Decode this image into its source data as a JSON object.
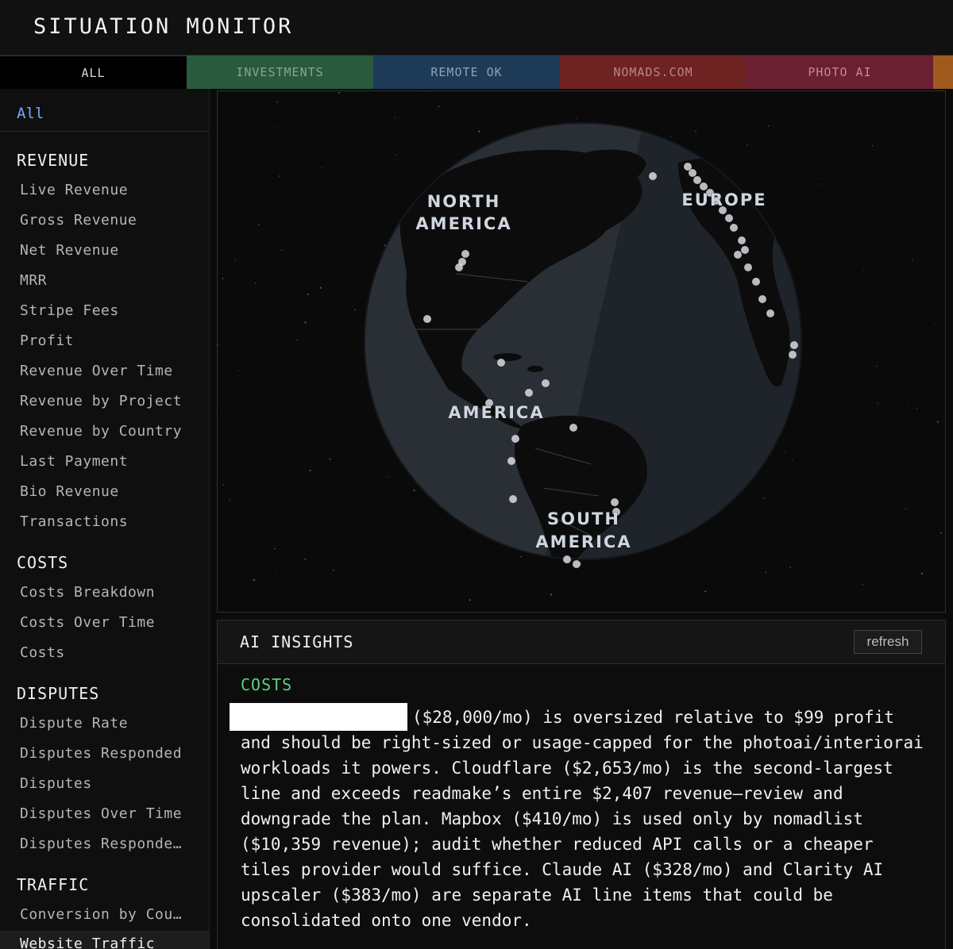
{
  "header": {
    "title": "SITUATION MONITOR"
  },
  "tabs": [
    "ALL",
    "INVESTMENTS",
    "REMOTE OK",
    "NOMADS.COM",
    "PHOTO AI"
  ],
  "sidebar": {
    "all": "All",
    "sections": {
      "revenue": {
        "title": "REVENUE",
        "items": [
          "Live Revenue",
          "Gross Revenue",
          "Net Revenue",
          "MRR",
          "Stripe Fees",
          "Profit",
          "Revenue Over Time",
          "Revenue by Project",
          "Revenue by Country",
          "Last Payment",
          "Bio Revenue",
          "Transactions"
        ]
      },
      "costs": {
        "title": "COSTS",
        "items": [
          "Costs Breakdown",
          "Costs Over Time",
          "Costs"
        ]
      },
      "disputes": {
        "title": "DISPUTES",
        "items": [
          "Dispute Rate",
          "Disputes Responded",
          "Disputes",
          "Disputes Over Time",
          "Disputes Responde…"
        ]
      },
      "traffic": {
        "title": "TRAFFIC",
        "items": [
          "Conversion by Cou…",
          "Website Traffic"
        ]
      }
    }
  },
  "map": {
    "labels": {
      "north_america_1": "NORTH",
      "north_america_2": "AMERICA",
      "europe": "EUROPE",
      "central_america": "AMERICA",
      "south_america_1": "SOUTH",
      "south_america_2": "AMERICA"
    },
    "colors": {
      "globe_night": "#2a2f36",
      "globe_day": "#1f242a",
      "land": "#0c0c0d",
      "marker": "#e6e6ee"
    }
  },
  "insights": {
    "title": "AI INSIGHTS",
    "refresh_label": "refresh",
    "category": "COSTS",
    "text": "($28,000/mo) is oversized relative to $99 profit and should be right-sized or usage-capped for the photoai/interiorai workloads it powers. Cloudflare ($2,653/mo) is the second-largest line and exceeds readmake’s entire $2,407 revenue—review and downgrade the plan. Mapbox ($410/mo) is used only by nomadlist ($10,359 revenue); audit whether reduced API calls or a cheaper tiles provider would suffice. Claude AI ($328/mo) and Clarity AI upscaler ($383/mo) are separate AI line items that could be consolidated onto one vendor."
  }
}
